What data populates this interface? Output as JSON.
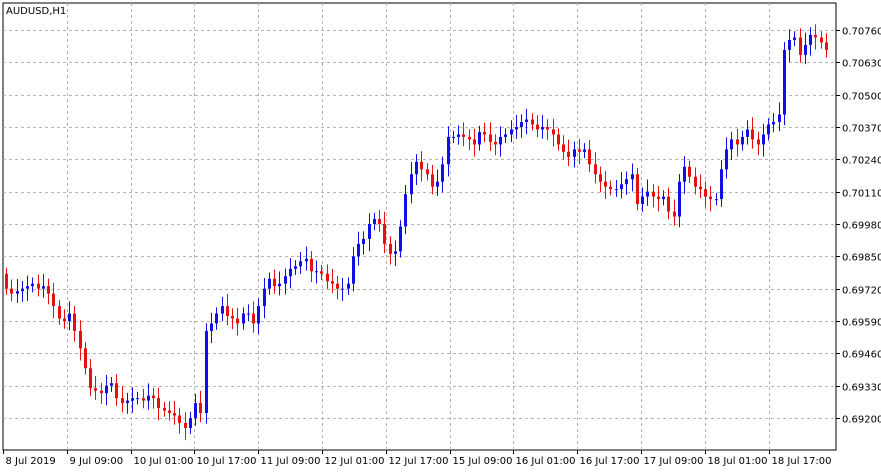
{
  "symbol_label": "AUDUSD,H1",
  "colors": {
    "bull": "#1010e6",
    "bear": "#e61010",
    "grid": "#b4b4b4",
    "frame": "#000000",
    "text": "#000000",
    "background": "#ffffff"
  },
  "chart_data": {
    "type": "candlestick",
    "title": "AUDUSD,H1",
    "timeframe": "H1",
    "ylim": [
      0.6909,
      0.678
    ],
    "y_ticks": [
      "0.70760",
      "0.70630",
      "0.70500",
      "0.70370",
      "0.70240",
      "0.70110",
      "0.69980",
      "0.69850",
      "0.69720",
      "0.69590",
      "0.69460",
      "0.69330",
      "0.69200"
    ],
    "x_ticks": [
      "8 Jul 2019",
      "9 Jul 09:00",
      "10 Jul 01:00",
      "10 Jul 17:00",
      "11 Jul 09:00",
      "12 Jul 01:00",
      "12 Jul 17:00",
      "15 Jul 09:00",
      "16 Jul 01:00",
      "16 Jul 17:00",
      "17 Jul 09:00",
      "18 Jul 01:00",
      "18 Jul 17:00"
    ],
    "y_tick_values": [
      0.7076,
      0.7063,
      0.705,
      0.7037,
      0.7024,
      0.7011,
      0.6998,
      0.6985,
      0.6972,
      0.6959,
      0.6946,
      0.6933,
      0.692
    ],
    "candles_close_approx": [
      0.6972,
      0.697,
      0.6971,
      0.6972,
      0.6973,
      0.6974,
      0.6972,
      0.6973,
      0.697,
      0.6965,
      0.696,
      0.6959,
      0.6962,
      0.6955,
      0.6948,
      0.694,
      0.6932,
      0.6931,
      0.693,
      0.6933,
      0.6934,
      0.6928,
      0.6926,
      0.6927,
      0.6928,
      0.6928,
      0.6927,
      0.6929,
      0.6928,
      0.6924,
      0.6923,
      0.6922,
      0.6921,
      0.6918,
      0.6916,
      0.692,
      0.6926,
      0.6922,
      0.6955,
      0.6958,
      0.6962,
      0.6965,
      0.6961,
      0.696,
      0.6958,
      0.6962,
      0.6962,
      0.6958,
      0.6965,
      0.6972,
      0.6976,
      0.6973,
      0.6974,
      0.6977,
      0.698,
      0.6981,
      0.6983,
      0.6984,
      0.6979,
      0.6979,
      0.6978,
      0.6975,
      0.6974,
      0.6972,
      0.6972,
      0.6974,
      0.6985,
      0.699,
      0.6992,
      0.6998,
      0.7,
      0.6998,
      0.699,
      0.6986,
      0.6987,
      0.6997,
      0.701,
      0.7018,
      0.7023,
      0.702,
      0.7018,
      0.7013,
      0.7015,
      0.7022,
      0.7033,
      0.7033,
      0.7034,
      0.7033,
      0.7032,
      0.703,
      0.7035,
      0.7034,
      0.7031,
      0.703,
      0.7033,
      0.7034,
      0.7036,
      0.7037,
      0.7039,
      0.704,
      0.7038,
      0.7036,
      0.7037,
      0.7036,
      0.7034,
      0.703,
      0.7027,
      0.7025,
      0.7028,
      0.7027,
      0.7028,
      0.7022,
      0.7018,
      0.7015,
      0.7013,
      0.7012,
      0.7012,
      0.7014,
      0.7016,
      0.7018,
      0.7006,
      0.7009,
      0.7011,
      0.7009,
      0.7008,
      0.7009,
      0.7003,
      0.7001,
      0.7015,
      0.7021,
      0.7017,
      0.7013,
      0.7012,
      0.7009,
      0.7008,
      0.7008,
      0.702,
      0.7028,
      0.7032,
      0.703,
      0.7033,
      0.7036,
      0.7032,
      0.703,
      0.7034,
      0.7038,
      0.7039,
      0.7042,
      0.7068,
      0.7072,
      0.7073,
      0.7066,
      0.707,
      0.7074,
      0.7073,
      0.7071,
      0.7068
    ]
  }
}
